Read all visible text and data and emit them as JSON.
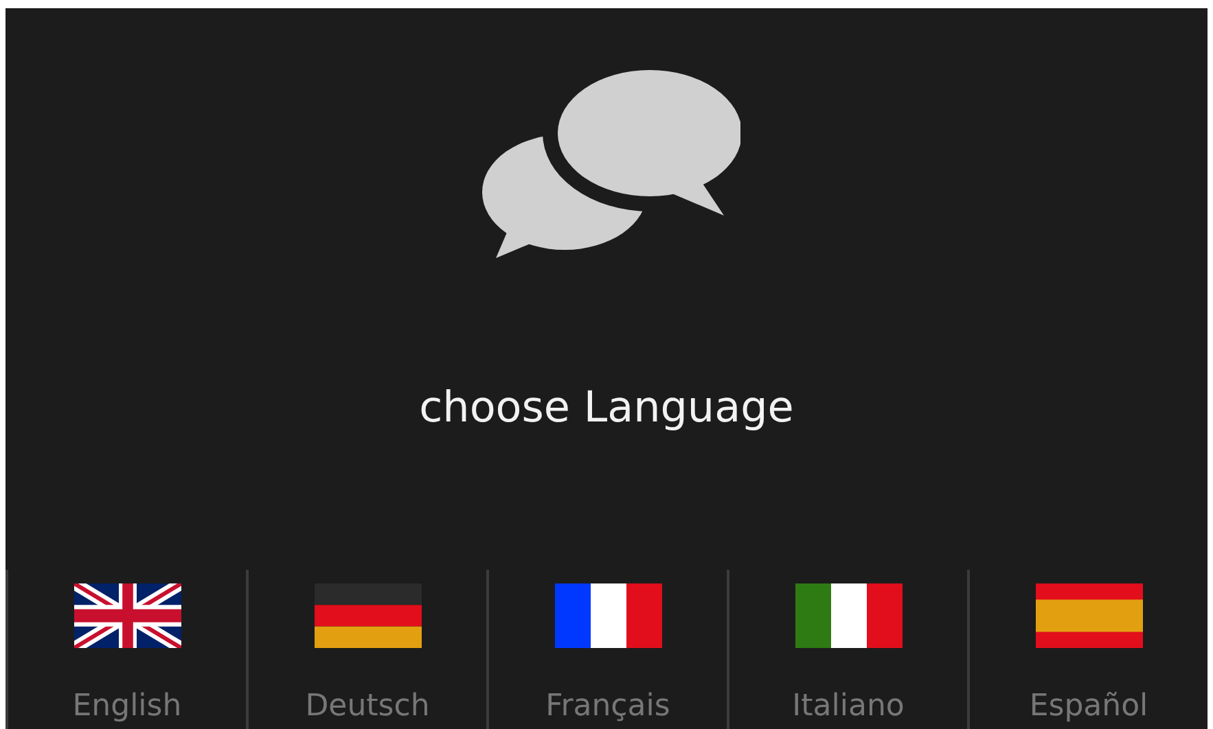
{
  "title": "choose Language",
  "languages": [
    {
      "label": "English",
      "kind": "uk"
    },
    {
      "label": "Deutsch",
      "kind": "de"
    },
    {
      "label": "Français",
      "kind": "fr"
    },
    {
      "label": "Italiano",
      "kind": "it"
    },
    {
      "label": "Español",
      "kind": "es"
    }
  ]
}
